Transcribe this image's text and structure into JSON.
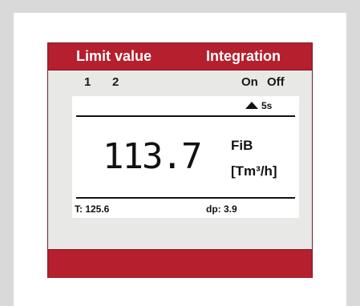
{
  "header": {
    "limit_value_label": "Limit value",
    "integration_label": "Integration"
  },
  "indicators": {
    "limit_1": "1",
    "limit_2": "2",
    "integration_on": "On",
    "integration_off": "Off"
  },
  "display": {
    "rate_indicator": "5s",
    "rate_icon": "triangle-up-icon",
    "value": "113.7",
    "quantity": "FiB",
    "unit": "[Tm³/h]",
    "footer_left": "T: 125.6",
    "footer_right": "dp: 3.9"
  },
  "colors": {
    "accent": "#b51f2e",
    "panel": "#e8e8e6",
    "screen": "#ffffff",
    "background": "#d9d9d9"
  }
}
